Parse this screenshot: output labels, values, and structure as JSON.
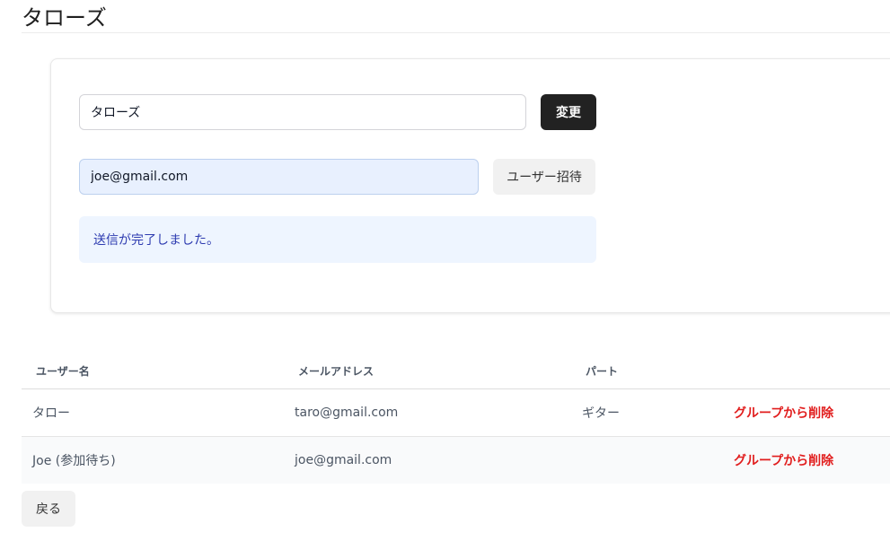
{
  "header": {
    "title": "タローズ"
  },
  "group_form": {
    "name_value": "タローズ",
    "change_label": "変更"
  },
  "invite_form": {
    "email_value": "joe@gmail.com",
    "invite_label": "ユーザー招待"
  },
  "alert": {
    "message": "送信が完了しました。"
  },
  "table": {
    "columns": [
      "ユーザー名",
      "メールアドレス",
      "パート"
    ],
    "rows": [
      {
        "username": "タロー",
        "email": "taro@gmail.com",
        "part": "ギター",
        "action": "グループから削除"
      },
      {
        "username": "Joe (参加待ち)",
        "email": "joe@gmail.com",
        "part": "",
        "action": "グループから削除"
      }
    ]
  },
  "footer": {
    "back_label": "戻る"
  },
  "colors": {
    "primary_button": "#222222",
    "danger_text": "#e11d1d",
    "alert_background": "#eef5ff",
    "alert_text": "#2d3bb0"
  }
}
